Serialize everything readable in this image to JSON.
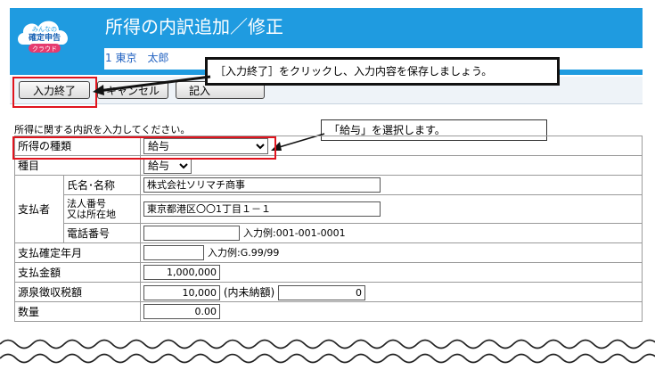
{
  "app": {
    "logo_lines": [
      "みんなの",
      "確定申告",
      "クラウド"
    ],
    "title": "所得の内訳追加／修正",
    "user": "1 東京　太郎"
  },
  "toolbar": {
    "finish_label": "入力終了",
    "cancel_label": "キャンセル",
    "third_label": "記入"
  },
  "callouts": {
    "save_note": "［入力終了］をクリックし、入力内容を保存しましょう。",
    "select_note": "「給与」を選択します。"
  },
  "section_label": "所得に関する内訳を入力してください。",
  "form": {
    "income_type_label": "所得の種類",
    "income_type_value": "給与",
    "category_label": "種目",
    "category_value": "給与",
    "payer_label": "支払者",
    "name_label": "氏名･名称",
    "name_value": "株式会社ソリマチ商事",
    "address_label_1": "法人番号",
    "address_label_2": "又は所在地",
    "address_value": "東京都港区〇〇1丁目１－１",
    "phone_label": "電話番号",
    "phone_value": "",
    "phone_hint": "入力例:001-001-0001",
    "date_label": "支払確定年月",
    "date_value": "",
    "date_hint": "入力例:G.99/99",
    "amount_label": "支払金額",
    "amount_value": "1,000,000",
    "tax_label": "源泉徴収税額",
    "tax_value": "10,000",
    "unpaid_label": "(内未納額)",
    "unpaid_value": "0",
    "qty_label": "数量",
    "qty_value": "0.00"
  },
  "colors": {
    "header": "#1f9be0",
    "highlight": "#e0141e"
  }
}
